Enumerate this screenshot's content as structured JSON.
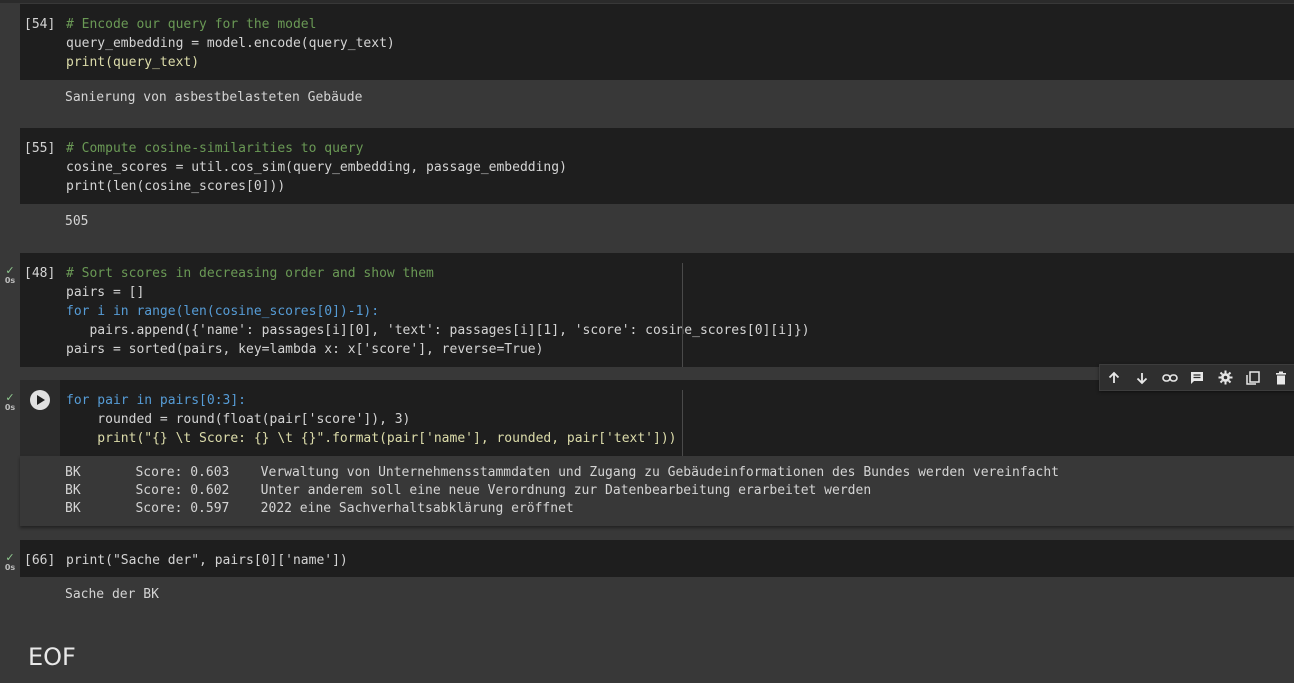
{
  "cells": [
    {
      "id": "cell-54",
      "exec_count": "[54]",
      "code_lines": [
        "# Encode our query for the model",
        "query_embedding = model.encode(query_text)",
        "print(query_text)"
      ],
      "output_lines": [
        "Sanierung von asbestbelasteten Gebäude"
      ]
    },
    {
      "id": "cell-55",
      "exec_count": "[55]",
      "code_lines": [
        "# Compute cosine-similarities to query",
        "cosine_scores = util.cos_sim(query_embedding, passage_embedding)",
        "print(len(cosine_scores[0]))"
      ],
      "output_lines": [
        "505"
      ]
    },
    {
      "id": "cell-48",
      "exec_count": "[48]",
      "status": {
        "check": "✓",
        "time": "0s"
      },
      "code_lines": [
        "# Sort scores in decreasing order and show them",
        "pairs = []",
        "for i in range(len(cosine_scores[0])-1):",
        "   pairs.append({'name': passages[i][0], 'text': passages[i][1], 'score': cosine_scores[0][i]})",
        "pairs = sorted(pairs, key=lambda x: x['score'], reverse=True)"
      ]
    },
    {
      "id": "cell-active",
      "status": {
        "check": "✓",
        "time": "0s"
      },
      "code_lines": [
        "for pair in pairs[0:3]:",
        "    rounded = round(float(pair['score']), 3)",
        "    print(\"{} \\t Score: {} \\t {}\".format(pair['name'], rounded, pair['text']))"
      ],
      "output_lines": [
        "BK       Score: 0.603    Verwaltung von Unternehmensstammdaten und Zugang zu Gebäudeinformationen des Bundes werden vereinfacht",
        "BK       Score: 0.602    Unter anderem soll eine neue Verordnung zur Datenbearbeitung erarbeitet werden",
        "BK       Score: 0.597    2022 eine Sachverhaltsabklärung eröffnet"
      ]
    },
    {
      "id": "cell-66",
      "exec_count": "[66]",
      "status": {
        "check": "✓",
        "time": "0s"
      },
      "code_lines": [
        "print(\"Sache der\", pairs[0]['name'])"
      ],
      "output_lines": [
        "Sache der BK"
      ]
    }
  ],
  "toolbar": {
    "icons": [
      "arrow-up-icon",
      "arrow-down-icon",
      "link-icon",
      "comment-icon",
      "gear-icon",
      "mirror-cell-icon",
      "trash-icon"
    ]
  },
  "eof_text": "EOF",
  "colors": {
    "background": "#383838",
    "code_bg": "#1e1e1e",
    "comment": "#6a9955",
    "keyword": "#569cd6",
    "function": "#dcdcaa",
    "string": "#ce9178",
    "number": "#b5cea8"
  }
}
